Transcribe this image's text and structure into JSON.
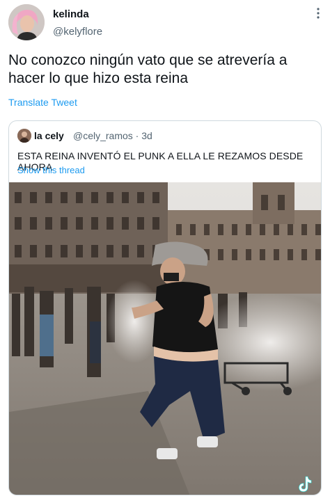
{
  "author": {
    "name": "kelinda",
    "handle": "@kelyflore"
  },
  "tweet": {
    "text": "No conozco ningún vato que se atrevería a hacer lo que hizo esta reina",
    "translate_label": "Translate Tweet"
  },
  "quoted": {
    "name": "la cely",
    "handle_time": "@cely_ramos · 3d",
    "text": "ESTA REINA INVENTÓ EL PUNK A ELLA LE REZAMOS DESDE AHORA",
    "thread_label": "Show this thread"
  },
  "icons": {
    "more": "more-vertical-icon",
    "video_brand": "tiktok-icon"
  },
  "colors": {
    "link": "#1d9bf0",
    "secondary_text": "#536471",
    "border": "#cfd9de"
  }
}
